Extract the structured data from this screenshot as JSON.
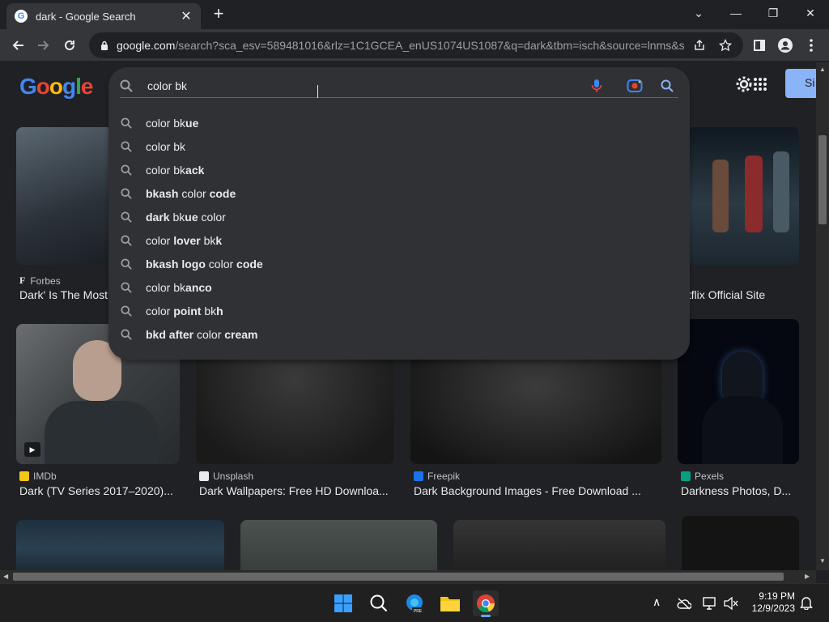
{
  "browser": {
    "tab_title": "dark - Google Search",
    "tab_favicon": "G",
    "url_host": "google.com",
    "url_path": "/search?sca_esv=589481016&rlz=1C1GCEA_enUS1074US1087&q=dark&tbm=isch&source=lnms&s..."
  },
  "search": {
    "query": "color bk",
    "suggestions": [
      {
        "pre": "color ",
        "bold": "",
        "mid": "bk",
        "boldtail": "ue",
        "tail": ""
      },
      {
        "pre": "color bk",
        "bold": "",
        "mid": "",
        "boldtail": "",
        "tail": ""
      },
      {
        "pre": "color bk",
        "bold": "",
        "mid": "",
        "boldtail": "ack",
        "tail": ""
      },
      {
        "pre": "",
        "bold": "bkash",
        "mid": " color ",
        "boldtail": "code",
        "tail": ""
      },
      {
        "pre": "",
        "bold": "dark",
        "mid": " bk",
        "boldtail": "ue",
        "tail": " color"
      },
      {
        "pre": "color ",
        "bold": "lover",
        "mid": " bk",
        "boldtail": "k",
        "tail": ""
      },
      {
        "pre": "",
        "bold": "bkash logo",
        "mid": " color ",
        "boldtail": "code",
        "tail": ""
      },
      {
        "pre": "color bk",
        "bold": "",
        "mid": "",
        "boldtail": "anco",
        "tail": ""
      },
      {
        "pre": "color ",
        "bold": "point",
        "mid": " bk",
        "boldtail": "h",
        "tail": ""
      },
      {
        "pre": "",
        "bold": "bkd after",
        "mid": " color ",
        "boldtail": "cream",
        "tail": ""
      }
    ]
  },
  "header": {
    "logo_text": "Google",
    "signin_label": "Si"
  },
  "results": [
    {
      "source": "Forbes",
      "caption": "Dark' Is The Most"
    },
    {
      "source": "",
      "caption": "etflix Official Site"
    },
    {
      "source": "IMDb",
      "caption": "Dark (TV Series 2017–2020)..."
    },
    {
      "source": "Unsplash",
      "caption": "Dark Wallpapers: Free HD Downloa..."
    },
    {
      "source": "Freepik",
      "caption": "Dark Background Images - Free Download ..."
    },
    {
      "source": "Pexels",
      "caption": "Darkness Photos, D..."
    }
  ],
  "taskbar": {
    "time": "9:19 PM",
    "date": "12/9/2023"
  },
  "colors": {
    "background": "#202124",
    "dropdown": "#303134",
    "accent": "#8ab4f8"
  }
}
